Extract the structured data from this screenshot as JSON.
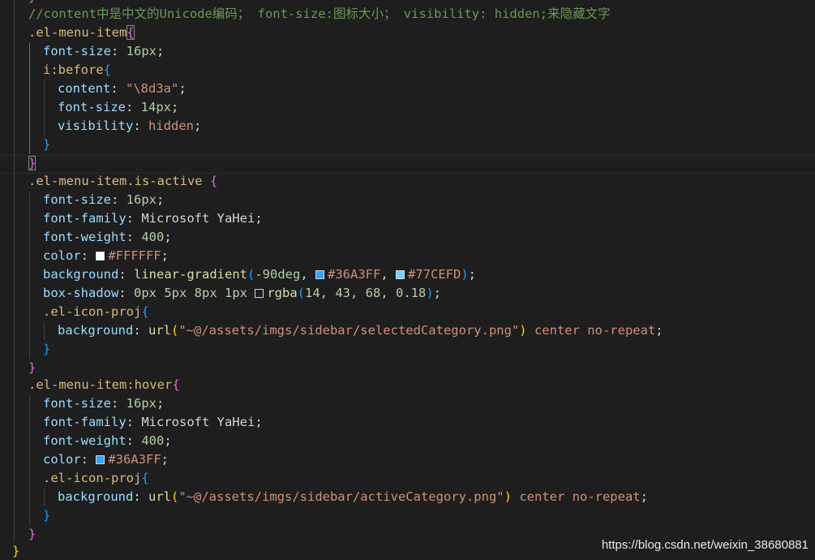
{
  "editor": {
    "comment": "//content中是中文的Unicode编码； font-size:图标大小； visibility: hidden;来隐藏文字",
    "block1": {
      "selector": ".el-menu-item",
      "open": "{",
      "fs_prop": "font-size",
      "fs_val": "16px",
      "nested_selector": "i:before",
      "nested_open": "{",
      "content_prop": "content",
      "content_val": "\"\\8d3a\"",
      "fs2_prop": "font-size",
      "fs2_val": "14px",
      "vis_prop": "visibility",
      "vis_val": "hidden",
      "nested_close": "}",
      "close": "}"
    },
    "block2": {
      "selector": ".el-menu-item.is-active",
      "open": "{",
      "fs_prop": "font-size",
      "fs_val": "16px",
      "ff_prop": "font-family",
      "ff_val": "Microsoft YaHei",
      "fw_prop": "font-weight",
      "fw_val": "400",
      "color_prop": "color",
      "color_val": "#FFFFFF",
      "color_swatch": "#FFFFFF",
      "bg_prop": "background",
      "bg_fn": "linear-gradient",
      "bg_deg": "-90deg",
      "bg_c1": "#36A3FF",
      "bg_c1_swatch": "#36A3FF",
      "bg_c2": "#77CEFD",
      "bg_c2_swatch": "#77CEFD",
      "bs_prop": "box-shadow",
      "bs_val": "0px 5px 8px 1px",
      "bs_fn": "rgba",
      "bs_args": "14, 43, 68, 0.18",
      "bs_swatch": "rgba(14, 43, 68, 0.18)",
      "nested_selector": ".el-icon-proj",
      "nested_open": "{",
      "nbg_prop": "background",
      "nbg_fn": "url",
      "nbg_str": "\"~@/assets/imgs/sidebar/selectedCategory.png\"",
      "nbg_rest": "center no-repeat",
      "nested_close": "}",
      "close": "}"
    },
    "block3": {
      "selector": ".el-menu-item:hover",
      "open": "{",
      "fs_prop": "font-size",
      "fs_val": "16px",
      "ff_prop": "font-family",
      "ff_val": "Microsoft YaHei",
      "fw_prop": "font-weight",
      "fw_val": "400",
      "color_prop": "color",
      "color_val": "#36A3FF",
      "color_swatch": "#36A3FF",
      "nested_selector": ".el-icon-proj",
      "nested_open": "{",
      "nbg_prop": "background",
      "nbg_fn": "url",
      "nbg_str": "\"~@/assets/imgs/sidebar/activeCategory.png\"",
      "nbg_rest": "center no-repeat",
      "nested_close": "}",
      "close": "}"
    },
    "outer_close": "}"
  },
  "watermark": "https://blog.csdn.net/weixin_38680881"
}
